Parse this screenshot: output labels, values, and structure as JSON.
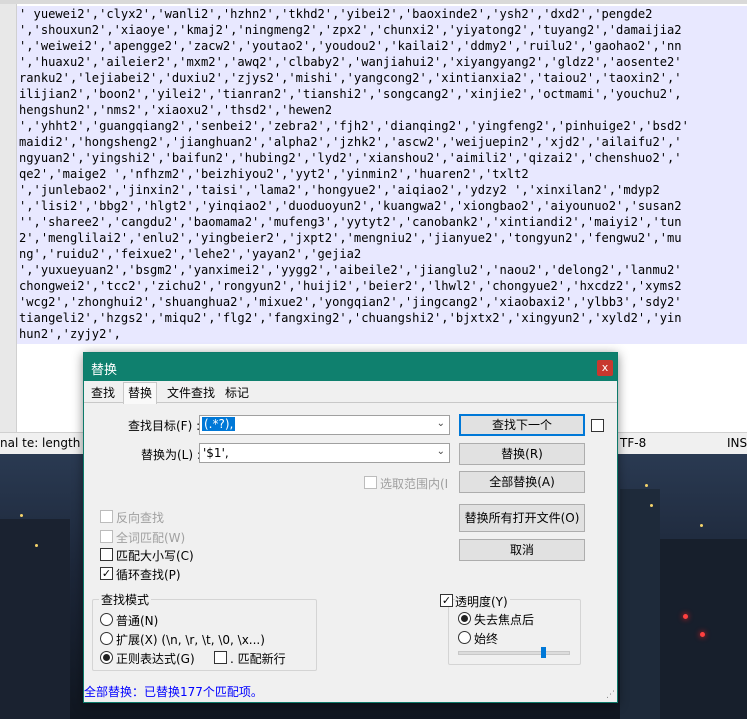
{
  "editor": {
    "lines": [
      "' yuewei2','clyx2','wanli2','hzhn2','tkhd2','yibei2','baoxinde2','ysh2','dxd2','pengde2",
      "','shouxun2','xiaoye','kmaj2','ningmeng2','zpx2','chunxi2','yiyatong2','tuyang2','damaijia2",
      "','weiwei2','apengge2','zacw2','youtao2','youdou2','kailai2','ddmy2','ruilu2','gaohao2','nn",
      "','huaxu2','aileier2','mxm2','awq2','clbaby2','wanjiahui2','xiyangyang2','gldz2','aosente2'",
      "ranku2','lejiabei2','duxiu2','zjys2','mishi','yangcong2','xintianxia2','taiou2','taoxin2','",
      "ilijian2','boon2','yilei2','tianran2','tianshi2','songcang2','xinjie2','octmami','youchu2',",
      "hengshun2','nms2','xiaoxu2','thsd2','hewen2",
      "','yhht2','guangqiang2','senbei2','zebra2','fjh2','dianqing2','yingfeng2','pinhuige2','bsd2'",
      "maidi2','hongsheng2','jianghuan2','alpha2','jzhk2','ascw2','weijuepin2','xjd2','ailaifu2','",
      "ngyuan2','yingshi2','baifun2','hubing2','lyd2','xianshou2','aimili2','qizai2','chenshuo2','",
      "qe2','maige2 ','nfhzm2','beizhiyou2','yyt2','yinmin2','huaren2','txlt2",
      "','junlebao2','jinxin2','taisi','lama2','hongyue2','aiqiao2','ydzy2 ','xinxilan2','mdyp2",
      "','lisi2','bbg2','hlgt2','yinqiao2','duoduoyun2','kuangwa2','xiongbao2','aiyounuo2','susan2",
      "'','sharee2','cangdu2','baomama2','mufeng3','yytyt2','canobank2','xintiandi2','maiyi2','tun",
      "2','menglilai2','enlu2','yingbeier2','jxpt2','mengniu2','jianyue2','tongyun2','fengwu2','mu",
      "ng','ruidu2','feixue2','lehe2','yayan2','gejia2",
      "','yuxueyuan2','bsgm2','yanximei2','yygg2','aibeile2','jianglu2','naou2','delong2','lanmu2'",
      "chongwei2','tcc2','zichu2','rongyun2','huiji2','beier2','lhwl2','chongyue2','hxcdz2','xyms2",
      "'wcg2','zhonghui2','shuanghua2','mixue2','yongqian2','jingcang2','xiaobaxi2','ylbb3','sdy2'",
      "tiangeli2','hzgs2','miqu2','flg2','fangxing2','chuangshi2','bjxtx2','xingyun2','xyld2','yin",
      "hun2','zyjy2',"
    ]
  },
  "statusbar": {
    "left": "nal te: length :",
    "encoding": "TF-8",
    "mode": "INS"
  },
  "dialog": {
    "title": "替换",
    "close_label": "x",
    "tabs": [
      "查找",
      "替换",
      "文件查找",
      "标记"
    ],
    "find_label": "查找目标(F) :",
    "find_value": "(.*?),",
    "replace_label": "替换为(L) :",
    "replace_value": "'$1',",
    "buttons": {
      "find_next": "查找下一个",
      "replace": "替换(R)",
      "replace_all": "全部替换(A)",
      "replace_all_open": "替换所有打开文件(O)",
      "cancel": "取消"
    },
    "in_selection": "选取范围内(I",
    "options": {
      "backward": "反向查找",
      "whole_word": "全词匹配(W)",
      "match_case": "匹配大小写(C)",
      "wrap": "循环查找(P)"
    },
    "search_mode": {
      "title": "查找模式",
      "normal": "普通(N)",
      "extended": "扩展(X) (\\n, \\r, \\t, \\0, \\x...)",
      "regex": "正则表达式(G)",
      "dot_newline": ". 匹配新行"
    },
    "transparency": {
      "title": "透明度(Y)",
      "on_lose_focus": "失去焦点后",
      "always": "始终",
      "level": 0.78
    },
    "status": "全部替换：已替换177个匹配项。"
  }
}
